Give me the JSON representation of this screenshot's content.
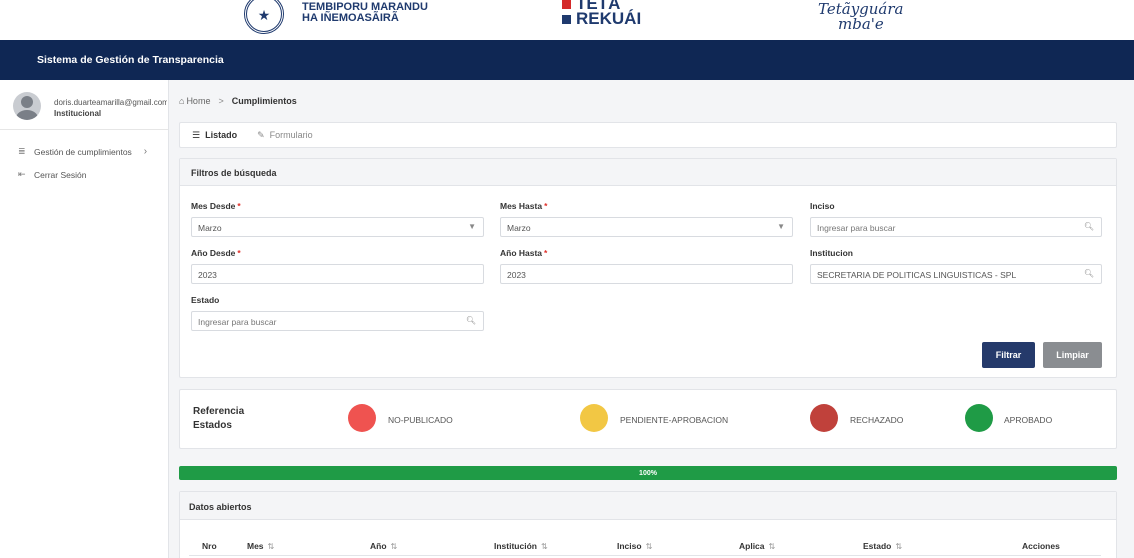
{
  "brand": {
    "gov_lines": [
      "",
      "TEMBIPORU MARANDU",
      "HA IÑEMOASÃIRÃ"
    ],
    "teta_lines": [
      "TETÃ",
      "REKUÁI"
    ],
    "teta_colors": [
      "#d42a2a",
      "#1f3a6e"
    ],
    "tetagua_lines": [
      "Tetãyguára",
      "mba'e"
    ]
  },
  "header": {
    "title": "Sistema de Gestión de Transparencia"
  },
  "sidebar": {
    "user_email": "doris.duarteamarilla@gmail.com",
    "user_role": "Institucional",
    "items": [
      {
        "label": "Gestión de cumplimientos",
        "icon": "list-icon",
        "chevron": "›"
      },
      {
        "label": "Cerrar Sesión",
        "icon": "logout-icon"
      }
    ]
  },
  "breadcrumb": {
    "home": "Home",
    "separator": ">",
    "current": "Cumplimientos"
  },
  "tabs": [
    {
      "label": "Listado",
      "icon": "list-icon",
      "active": true
    },
    {
      "label": "Formulario",
      "icon": "edit-icon",
      "active": false
    }
  ],
  "filters": {
    "title": "Filtros de búsqueda",
    "required_mark": "*",
    "mes_desde": {
      "label": "Mes Desde",
      "value": "Marzo"
    },
    "mes_hasta": {
      "label": "Mes Hasta",
      "value": "Marzo"
    },
    "inciso": {
      "label": "Inciso",
      "placeholder": "Ingresar para buscar"
    },
    "anio_desde": {
      "label": "Año Desde",
      "value": "2023"
    },
    "anio_hasta": {
      "label": "Año Hasta",
      "value": "2023"
    },
    "institucion": {
      "label": "Institucion",
      "value": "SECRETARIA DE POLITICAS LINGUISTICAS - SPL"
    },
    "estado": {
      "label": "Estado",
      "placeholder": "Ingresar para buscar"
    },
    "filter_button": "Filtrar",
    "clear_button": "Limpiar"
  },
  "legend": {
    "title": "Referencia Estados",
    "items": [
      {
        "label": "NO-PUBLICADO",
        "color": "#ef5350"
      },
      {
        "label": "PENDIENTE-APROBACION",
        "color": "#f2c744"
      },
      {
        "label": "RECHAZADO",
        "color": "#c0413b"
      },
      {
        "label": "APROBADO",
        "color": "#1f9b46"
      }
    ]
  },
  "progress": {
    "label": "100%",
    "value": 1.0
  },
  "datos": {
    "title": "Datos abiertos",
    "sort_glyph": "⇅",
    "columns": [
      "Nro",
      "Mes",
      "Año",
      "Institución",
      "Inciso",
      "Aplica",
      "Estado",
      "Acciones"
    ]
  },
  "colors": {
    "navy": "#0f2754",
    "primary_button": "#253a6b",
    "secondary_button": "#8a8d91"
  }
}
